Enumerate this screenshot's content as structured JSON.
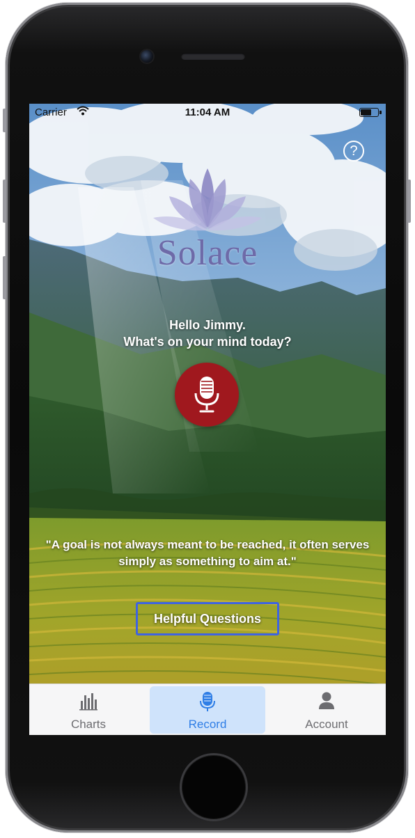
{
  "status_bar": {
    "carrier": "Carrier",
    "time": "11:04 AM"
  },
  "help": {
    "icon": "question-icon",
    "glyph": "?"
  },
  "brand": {
    "name": "Solace",
    "logo_icon": "lotus-logo-icon"
  },
  "greeting": {
    "line1": "Hello Jimmy.",
    "line2": "What's on your mind today?"
  },
  "record": {
    "icon": "microphone-icon",
    "color": "#a0181e"
  },
  "quote": {
    "text": "\"A goal is not always meant to be reached, it often serves simply as something to aim at.\""
  },
  "helpful_questions": {
    "label": "Helpful Questions",
    "border_color": "#3f64e0"
  },
  "tabs": [
    {
      "label": "Charts",
      "icon": "bar-chart-icon",
      "active": false
    },
    {
      "label": "Record",
      "icon": "microphone-icon",
      "active": true
    },
    {
      "label": "Account",
      "icon": "person-icon",
      "active": false
    }
  ],
  "colors": {
    "accent": "#2f7ee6",
    "brand_purple": "#6e6aa8"
  }
}
